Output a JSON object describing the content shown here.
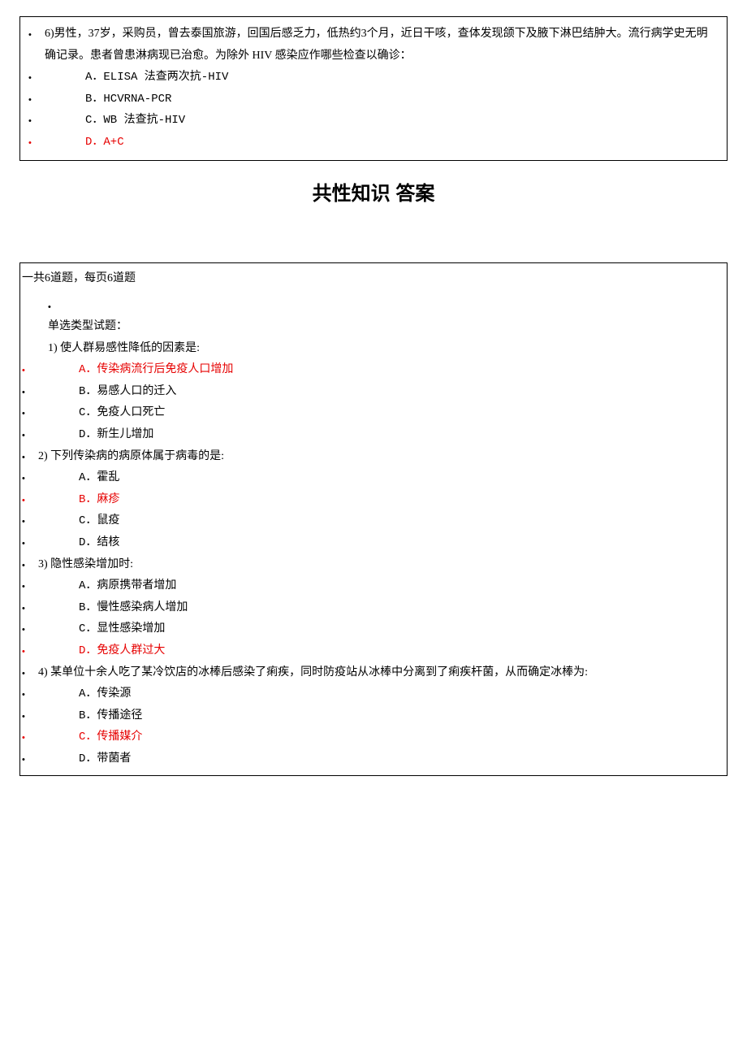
{
  "box1": {
    "q6": {
      "stem": "6)男性，37岁，采购员，曾去泰国旅游，回国后感乏力，低热约3个月，近日干咳，查体发现颌下及腋下淋巴结肿大。流行病学史无明确记录。患者曾患淋病现已治愈。为除外 HIV 感染应作哪些检查以确诊：",
      "options": {
        "a": "A．ELISA 法查两次抗-HIV",
        "b": "B．HCVRNA-PCR",
        "c": "C．WB 法查抗-HIV",
        "d": "D．A+C"
      }
    }
  },
  "section_title": "共性知识 答案",
  "box2": {
    "info": "一共6道题，每页6道题",
    "type_heading": "单选类型试题：",
    "q1": {
      "stem": "1) 使人群易感性降低的因素是:",
      "options": {
        "a": "A．传染病流行后免疫人口增加",
        "b": "B．易感人口的迁入",
        "c": "C．免疫人口死亡",
        "d": "D．新生儿增加"
      }
    },
    "q2": {
      "stem": "2) 下列传染病的病原体属于病毒的是:",
      "options": {
        "a": "A．霍乱",
        "b": "B．麻疹",
        "c": "C．鼠疫",
        "d": "D．结核"
      }
    },
    "q3": {
      "stem": "3) 隐性感染增加时:",
      "options": {
        "a": "A．病原携带者增加",
        "b": "B．慢性感染病人增加",
        "c": "C．显性感染增加",
        "d": "D．免疫人群过大"
      }
    },
    "q4": {
      "stem": "4) 某单位十余人吃了某冷饮店的冰棒后感染了痢疾，同时防疫站从冰棒中分离到了痢疾杆菌，从而确定冰棒为:",
      "options": {
        "a": "A．传染源",
        "b": "B．传播途径",
        "c": "C．传播媒介",
        "d": "D．带菌者"
      }
    }
  }
}
